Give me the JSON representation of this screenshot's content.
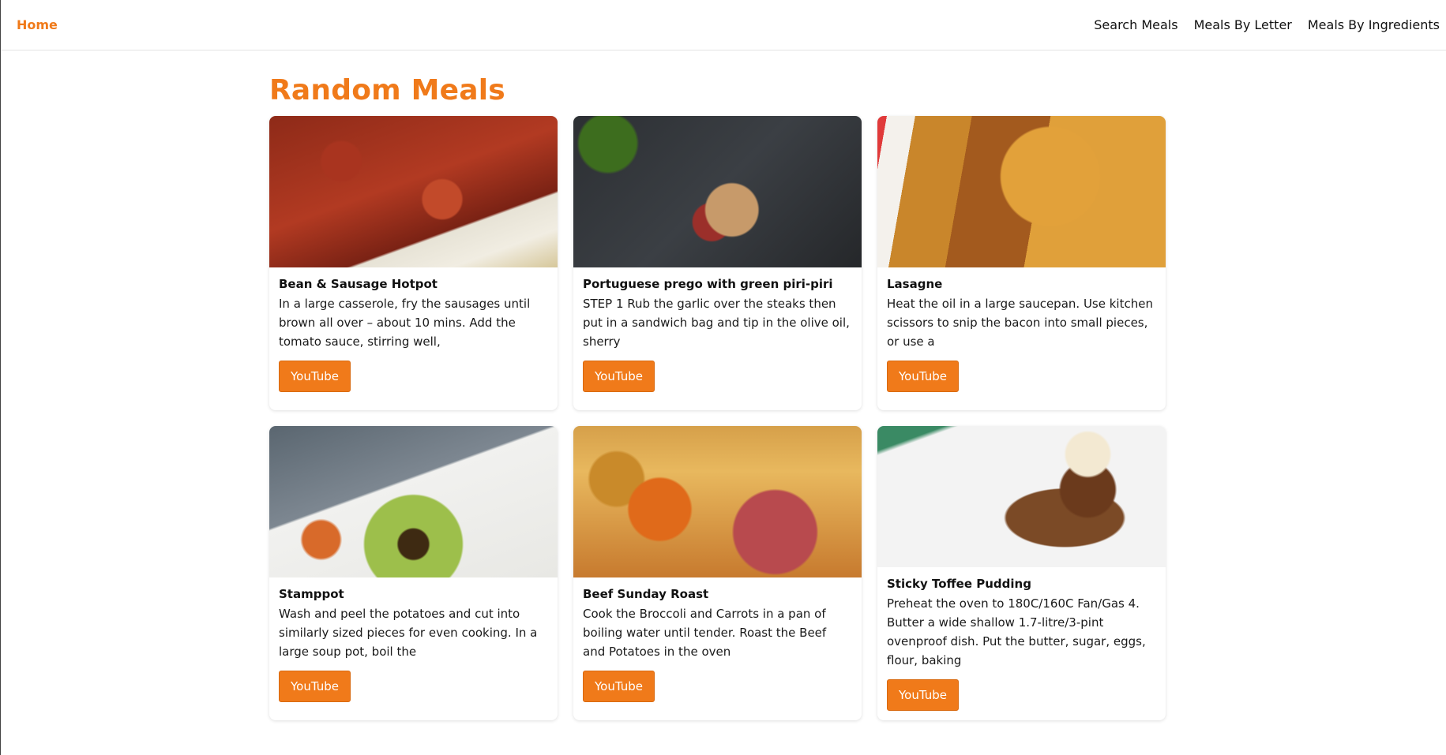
{
  "nav": {
    "home": "Home",
    "links": [
      "Search Meals",
      "Meals By Letter",
      "Meals By Ingredients"
    ]
  },
  "page": {
    "title": "Random Meals"
  },
  "meals": [
    {
      "name": "Bean & Sausage Hotpot",
      "desc": "In a large casserole, fry the sausages until brown all over – about 10 mins. Add the tomato sauce, stirring well,",
      "button": "YouTube"
    },
    {
      "name": "Portuguese prego with green piri-piri",
      "desc": "STEP 1 Rub the garlic over the steaks then put in a sandwich bag and tip in the olive oil, sherry",
      "button": "YouTube"
    },
    {
      "name": "Lasagne",
      "desc": "Heat the oil in a large saucepan. Use kitchen scissors to snip the bacon into small pieces, or use a",
      "button": "YouTube"
    },
    {
      "name": "Stamppot",
      "desc": "Wash and peel the potatoes and cut into similarly sized pieces for even cooking. In a large soup pot, boil the",
      "button": "YouTube"
    },
    {
      "name": "Beef Sunday Roast",
      "desc": "Cook the Broccoli and Carrots in a pan of boiling water until tender. Roast the Beef and Potatoes in the oven",
      "button": "YouTube"
    },
    {
      "name": "Sticky Toffee Pudding",
      "desc": "Preheat the oven to 180C/160C Fan/Gas 4. Butter a wide shallow 1.7-litre/3-pint ovenproof dish. Put the butter, sugar, eggs, flour, baking",
      "button": "YouTube"
    }
  ],
  "colors": {
    "accent": "#f07a1a"
  }
}
